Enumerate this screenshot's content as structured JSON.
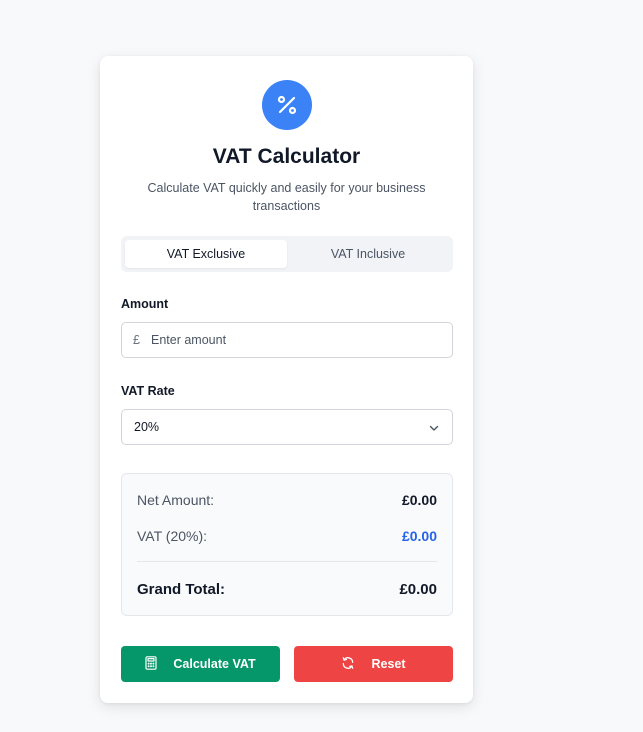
{
  "header": {
    "title": "VAT Calculator",
    "subtitle": "Calculate VAT quickly and easily for your business transactions",
    "logo_icon": "percent-icon",
    "accent": "#3b82f6"
  },
  "tabs": [
    {
      "label": "VAT Exclusive",
      "active": true
    },
    {
      "label": "VAT Inclusive",
      "active": false
    }
  ],
  "amount": {
    "label": "Amount",
    "currency_symbol": "£",
    "placeholder": "Enter amount",
    "value": ""
  },
  "vat_rate": {
    "label": "VAT Rate",
    "selected": "20%"
  },
  "results": {
    "net_label": "Net Amount:",
    "net_value": "£0.00",
    "vat_label": "VAT (20%):",
    "vat_value": "£0.00",
    "total_label": "Grand Total:",
    "total_value": "£0.00"
  },
  "buttons": {
    "calculate_label": "Calculate VAT",
    "calculate_icon": "calculator-icon",
    "calculate_color": "#059669",
    "reset_label": "Reset",
    "reset_icon": "refresh-icon",
    "reset_color": "#ef4444"
  }
}
